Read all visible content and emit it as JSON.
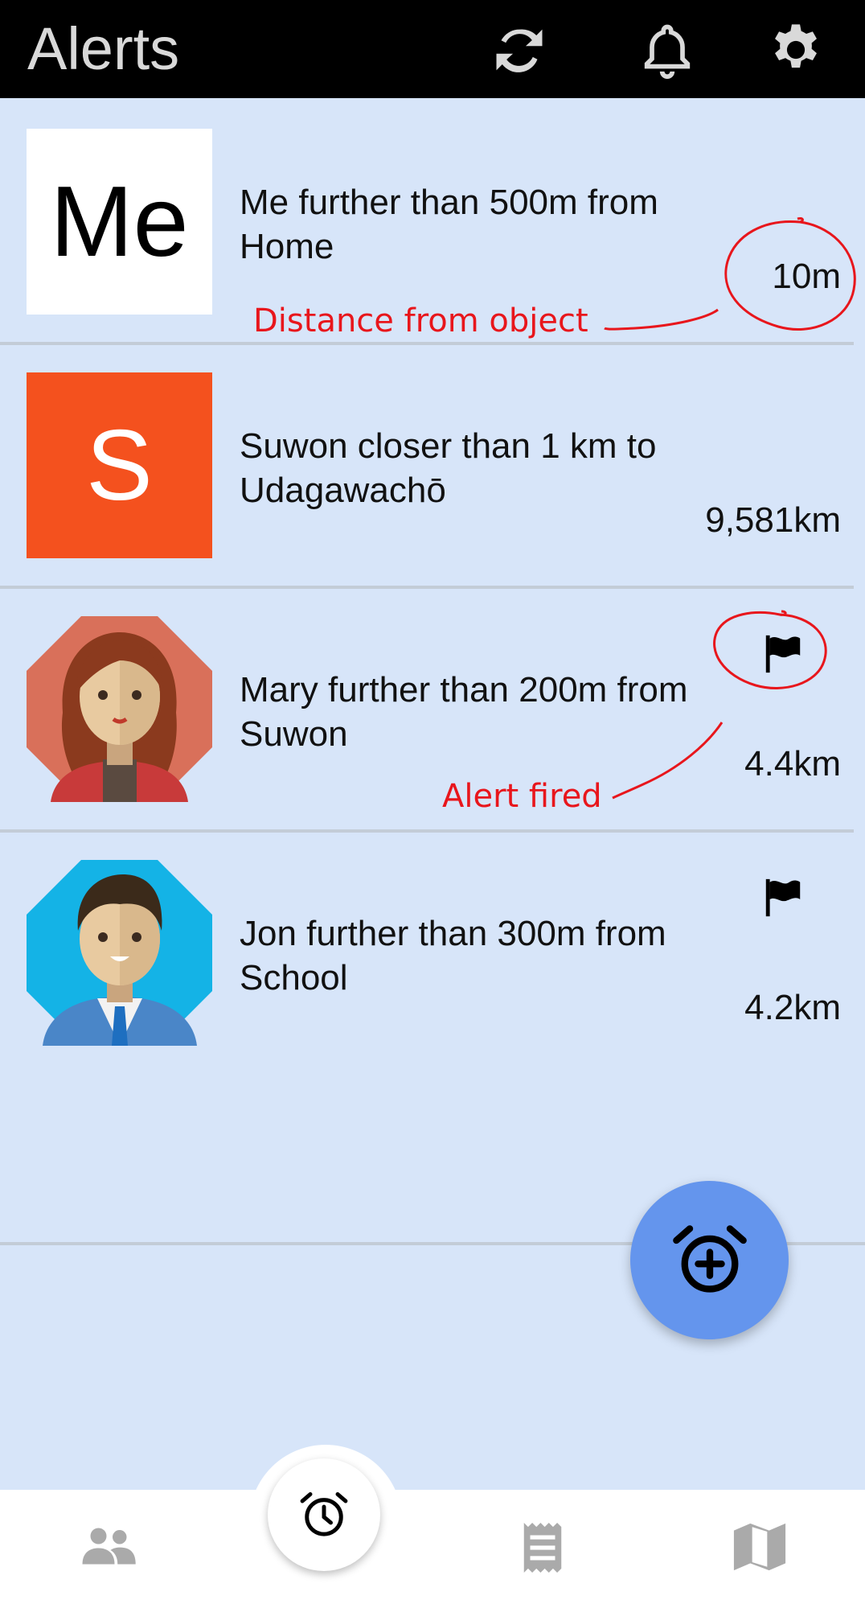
{
  "header": {
    "title": "Alerts",
    "icons": [
      "refresh-icon",
      "bell-icon",
      "settings-gear-icon"
    ]
  },
  "alerts": [
    {
      "avatar_type": "letter",
      "avatar_letter": "Me",
      "avatar_bg": "#ffffff",
      "avatar_fg": "#000000",
      "text": "Me further than 500m from Home",
      "distance": "10m",
      "fired": false
    },
    {
      "avatar_type": "letter",
      "avatar_letter": "S",
      "avatar_bg": "#f4511e",
      "avatar_fg": "#ffffff",
      "text": "Suwon closer than 1 km to Udagawachō",
      "distance": "9,581km",
      "fired": false
    },
    {
      "avatar_type": "woman-avatar",
      "text": "Mary further than 200m from Suwon",
      "distance": "4.4km",
      "fired": true
    },
    {
      "avatar_type": "man-avatar",
      "text": "Jon further than 300m from School",
      "distance": "4.2km",
      "fired": true
    }
  ],
  "annotations": {
    "distance_label": "Distance from object",
    "fired_label": "Alert fired",
    "color": "#e8161c"
  },
  "fab": {
    "icon": "add-alarm-icon",
    "color": "#6495ed"
  },
  "bottom_nav": {
    "items": [
      "people-icon",
      "alarm-clock-icon",
      "receipt-icon",
      "map-icon"
    ],
    "active": "alarm-clock-icon"
  }
}
